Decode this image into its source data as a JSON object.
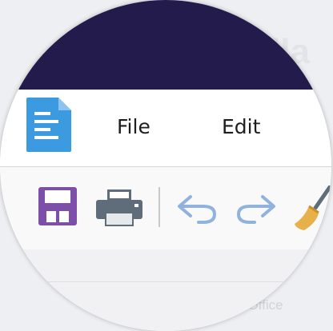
{
  "background": {
    "partial_heading": "lla",
    "footer_text": "eOffice"
  },
  "app": {
    "icon": "document-icon",
    "colors": {
      "titlebar": "#221b4b",
      "app_icon": "#3c9ae0",
      "save_icon": "#7d4fa8",
      "undo_redo": "#8fb3dd",
      "brush": "#e7b04a"
    }
  },
  "menu": {
    "items": [
      {
        "label": "File"
      },
      {
        "label": "Edit"
      }
    ]
  },
  "toolbar": {
    "icons": [
      "save-icon",
      "print-icon",
      "undo-icon",
      "redo-icon",
      "clone-formatting-icon"
    ]
  }
}
